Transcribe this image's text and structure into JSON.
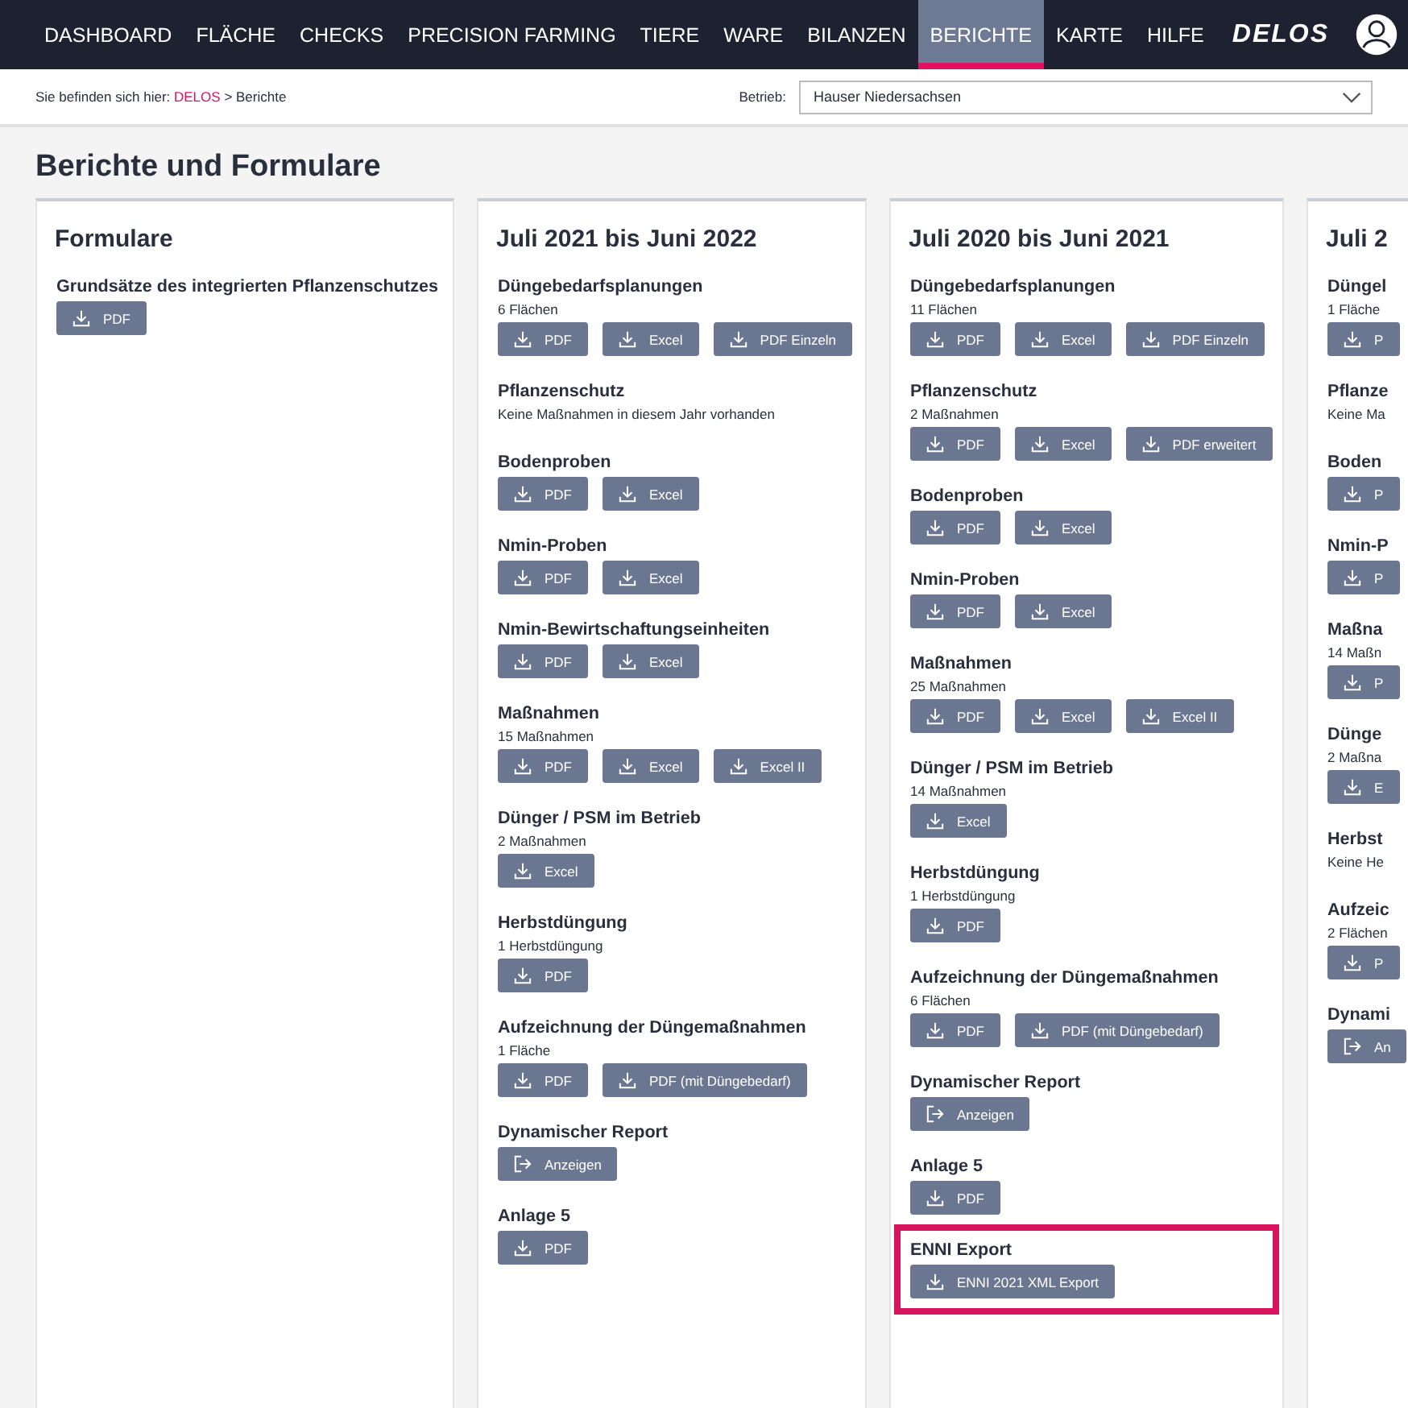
{
  "nav": {
    "items": [
      {
        "label": "DASHBOARD",
        "selected": false
      },
      {
        "label": "FLÄCHE",
        "selected": false
      },
      {
        "label": "CHECKS",
        "selected": false
      },
      {
        "label": "PRECISION FARMING",
        "selected": false
      },
      {
        "label": "TIERE",
        "selected": false
      },
      {
        "label": "WARE",
        "selected": false
      },
      {
        "label": "BILANZEN",
        "selected": false
      },
      {
        "label": "BERICHTE",
        "selected": true
      },
      {
        "label": "KARTE",
        "selected": false
      },
      {
        "label": "HILFE",
        "selected": false
      }
    ],
    "logo": "DELOS"
  },
  "breadcrumb": {
    "prefix": "Sie befinden sich hier:",
    "link": "DELOS",
    "rest": "> Berichte"
  },
  "betrieb": {
    "label": "Betrieb:",
    "value": "Hauser Niedersachsen"
  },
  "page_title": "Berichte und Formulare",
  "cards": [
    {
      "title": "Formulare",
      "sections": [
        {
          "title": "Grundsätze des integrierten Pflanzenschutzes",
          "highlighted": false,
          "buttons": [
            {
              "kind": "download",
              "label": "PDF"
            }
          ]
        }
      ]
    },
    {
      "title": "Juli 2021 bis Juni 2022",
      "sections": [
        {
          "title": "Düngebedarfsplanungen",
          "note": "6 Flächen",
          "highlighted": false,
          "buttons": [
            {
              "kind": "download",
              "label": "PDF"
            },
            {
              "kind": "download",
              "label": "Excel"
            },
            {
              "kind": "download",
              "label": "PDF Einzeln"
            }
          ]
        },
        {
          "title": "Pflanzenschutz",
          "note": "Keine Maßnahmen in diesem Jahr vorhanden",
          "highlighted": false
        },
        {
          "title": "Bodenproben",
          "highlighted": false,
          "buttons": [
            {
              "kind": "download",
              "label": "PDF"
            },
            {
              "kind": "download",
              "label": "Excel"
            }
          ]
        },
        {
          "title": "Nmin-Proben",
          "highlighted": false,
          "buttons": [
            {
              "kind": "download",
              "label": "PDF"
            },
            {
              "kind": "download",
              "label": "Excel"
            }
          ]
        },
        {
          "title": "Nmin-Bewirtschaftungseinheiten",
          "highlighted": false,
          "buttons": [
            {
              "kind": "download",
              "label": "PDF"
            },
            {
              "kind": "download",
              "label": "Excel"
            }
          ]
        },
        {
          "title": "Maßnahmen",
          "note": "15 Maßnahmen",
          "highlighted": false,
          "buttons": [
            {
              "kind": "download",
              "label": "PDF"
            },
            {
              "kind": "download",
              "label": "Excel"
            },
            {
              "kind": "download",
              "label": "Excel II"
            }
          ]
        },
        {
          "title": "Dünger / PSM im Betrieb",
          "note": "2 Maßnahmen",
          "highlighted": false,
          "buttons": [
            {
              "kind": "download",
              "label": "Excel"
            }
          ]
        },
        {
          "title": "Herbstdüngung",
          "note": "1 Herbstdüngung",
          "highlighted": false,
          "buttons": [
            {
              "kind": "download",
              "label": "PDF"
            }
          ]
        },
        {
          "title": "Aufzeichnung der Düngemaßnahmen",
          "note": "1 Fläche",
          "highlighted": false,
          "buttons": [
            {
              "kind": "download",
              "label": "PDF"
            },
            {
              "kind": "download",
              "label": "PDF (mit Düngebedarf)"
            }
          ]
        },
        {
          "title": "Dynamischer Report",
          "highlighted": false,
          "buttons": [
            {
              "kind": "open",
              "label": "Anzeigen"
            }
          ]
        },
        {
          "title": "Anlage 5",
          "highlighted": false,
          "buttons": [
            {
              "kind": "download",
              "label": "PDF"
            }
          ]
        }
      ]
    },
    {
      "title": "Juli 2020 bis Juni 2021",
      "sections": [
        {
          "title": "Düngebedarfsplanungen",
          "note": "11 Flächen",
          "highlighted": false,
          "buttons": [
            {
              "kind": "download",
              "label": "PDF"
            },
            {
              "kind": "download",
              "label": "Excel"
            },
            {
              "kind": "download",
              "label": "PDF Einzeln"
            }
          ]
        },
        {
          "title": "Pflanzenschutz",
          "note": "2 Maßnahmen",
          "highlighted": false,
          "buttons": [
            {
              "kind": "download",
              "label": "PDF"
            },
            {
              "kind": "download",
              "label": "Excel"
            },
            {
              "kind": "download",
              "label": "PDF erweitert"
            }
          ]
        },
        {
          "title": "Bodenproben",
          "highlighted": false,
          "buttons": [
            {
              "kind": "download",
              "label": "PDF"
            },
            {
              "kind": "download",
              "label": "Excel"
            }
          ]
        },
        {
          "title": "Nmin-Proben",
          "highlighted": false,
          "buttons": [
            {
              "kind": "download",
              "label": "PDF"
            },
            {
              "kind": "download",
              "label": "Excel"
            }
          ]
        },
        {
          "title": "Maßnahmen",
          "note": "25 Maßnahmen",
          "highlighted": false,
          "buttons": [
            {
              "kind": "download",
              "label": "PDF"
            },
            {
              "kind": "download",
              "label": "Excel"
            },
            {
              "kind": "download",
              "label": "Excel II"
            }
          ]
        },
        {
          "title": "Dünger / PSM im Betrieb",
          "note": "14 Maßnahmen",
          "highlighted": false,
          "buttons": [
            {
              "kind": "download",
              "label": "Excel"
            }
          ]
        },
        {
          "title": "Herbstdüngung",
          "note": "1 Herbstdüngung",
          "highlighted": false,
          "buttons": [
            {
              "kind": "download",
              "label": "PDF"
            }
          ]
        },
        {
          "title": "Aufzeichnung der Düngemaßnahmen",
          "note": "6 Flächen",
          "highlighted": false,
          "buttons": [
            {
              "kind": "download",
              "label": "PDF"
            },
            {
              "kind": "download",
              "label": "PDF (mit Düngebedarf)"
            }
          ]
        },
        {
          "title": "Dynamischer Report",
          "highlighted": false,
          "buttons": [
            {
              "kind": "open",
              "label": "Anzeigen"
            }
          ]
        },
        {
          "title": "Anlage 5",
          "highlighted": false,
          "buttons": [
            {
              "kind": "download",
              "label": "PDF"
            }
          ]
        },
        {
          "title": "ENNI Export",
          "highlighted": true,
          "buttons": [
            {
              "kind": "download",
              "label": "ENNI 2021 XML Export"
            }
          ]
        }
      ]
    },
    {
      "title": "Juli 2",
      "sections": [
        {
          "title": "Düngel",
          "note": "1 Fläche",
          "highlighted": false,
          "buttons": [
            {
              "kind": "download",
              "label": "P"
            }
          ]
        },
        {
          "title": "Pflanze",
          "note": "Keine Ma",
          "highlighted": false
        },
        {
          "title": "Boden",
          "highlighted": false,
          "buttons": [
            {
              "kind": "download",
              "label": "P"
            }
          ]
        },
        {
          "title": "Nmin-P",
          "highlighted": false,
          "buttons": [
            {
              "kind": "download",
              "label": "P"
            }
          ]
        },
        {
          "title": "Maßna",
          "note": "14 Maßn",
          "highlighted": false,
          "buttons": [
            {
              "kind": "download",
              "label": "P"
            }
          ]
        },
        {
          "title": "Dünge",
          "note": "2 Maßna",
          "highlighted": false,
          "buttons": [
            {
              "kind": "download",
              "label": "E"
            }
          ]
        },
        {
          "title": "Herbst",
          "note": "Keine He",
          "highlighted": false
        },
        {
          "title": "Aufzeic",
          "note": "2 Flächen",
          "highlighted": false,
          "buttons": [
            {
              "kind": "download",
              "label": "P"
            }
          ]
        },
        {
          "title": "Dynami",
          "highlighted": false,
          "buttons": [
            {
              "kind": "open",
              "label": "An"
            }
          ]
        }
      ]
    }
  ]
}
